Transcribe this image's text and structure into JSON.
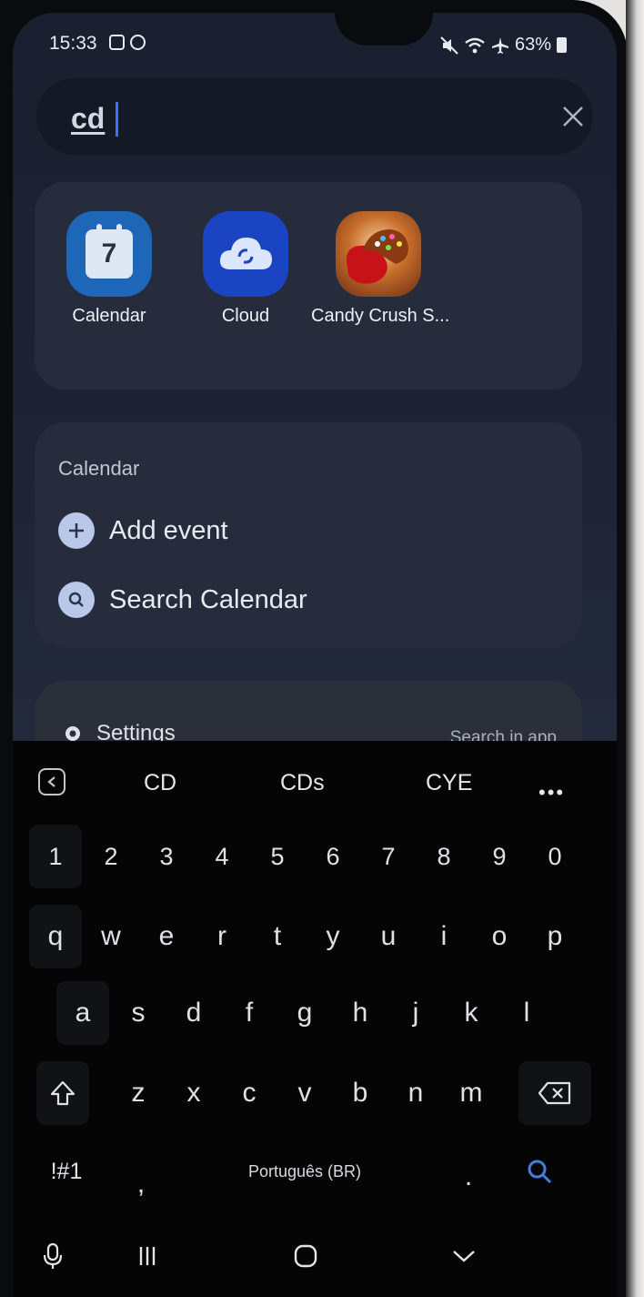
{
  "status_bar": {
    "time": "15:33",
    "battery": "63%"
  },
  "search": {
    "value": "cd"
  },
  "apps": [
    {
      "label": "Calendar",
      "icon": "calendar-icon",
      "day": "7"
    },
    {
      "label": "Cloud",
      "icon": "cloud-icon"
    },
    {
      "label": "Candy Crush S...",
      "icon": "candy-crush-icon"
    }
  ],
  "calendar_section": {
    "heading": "Calendar",
    "actions": [
      {
        "label": "Add event",
        "icon": "plus-icon"
      },
      {
        "label": "Search Calendar",
        "icon": "search-icon"
      }
    ]
  },
  "settings_section": {
    "label": "Settings",
    "search_in_app": "Search in app"
  },
  "suggestions": [
    "CD",
    "CDs",
    "CYE"
  ],
  "keyboard": {
    "numbers": [
      "1",
      "2",
      "3",
      "4",
      "5",
      "6",
      "7",
      "8",
      "9",
      "0"
    ],
    "row1": [
      "q",
      "w",
      "e",
      "r",
      "t",
      "y",
      "u",
      "i",
      "o",
      "p"
    ],
    "row2": [
      "a",
      "s",
      "d",
      "f",
      "g",
      "h",
      "j",
      "k",
      "l"
    ],
    "row3": [
      "z",
      "x",
      "c",
      "v",
      "b",
      "n",
      "m"
    ],
    "symbols_key": "!#1",
    "comma": ",",
    "language": "Português (BR)",
    "period": "."
  },
  "colors": {
    "accent": "#3f6fff",
    "search_key": "#3f7fe0"
  }
}
